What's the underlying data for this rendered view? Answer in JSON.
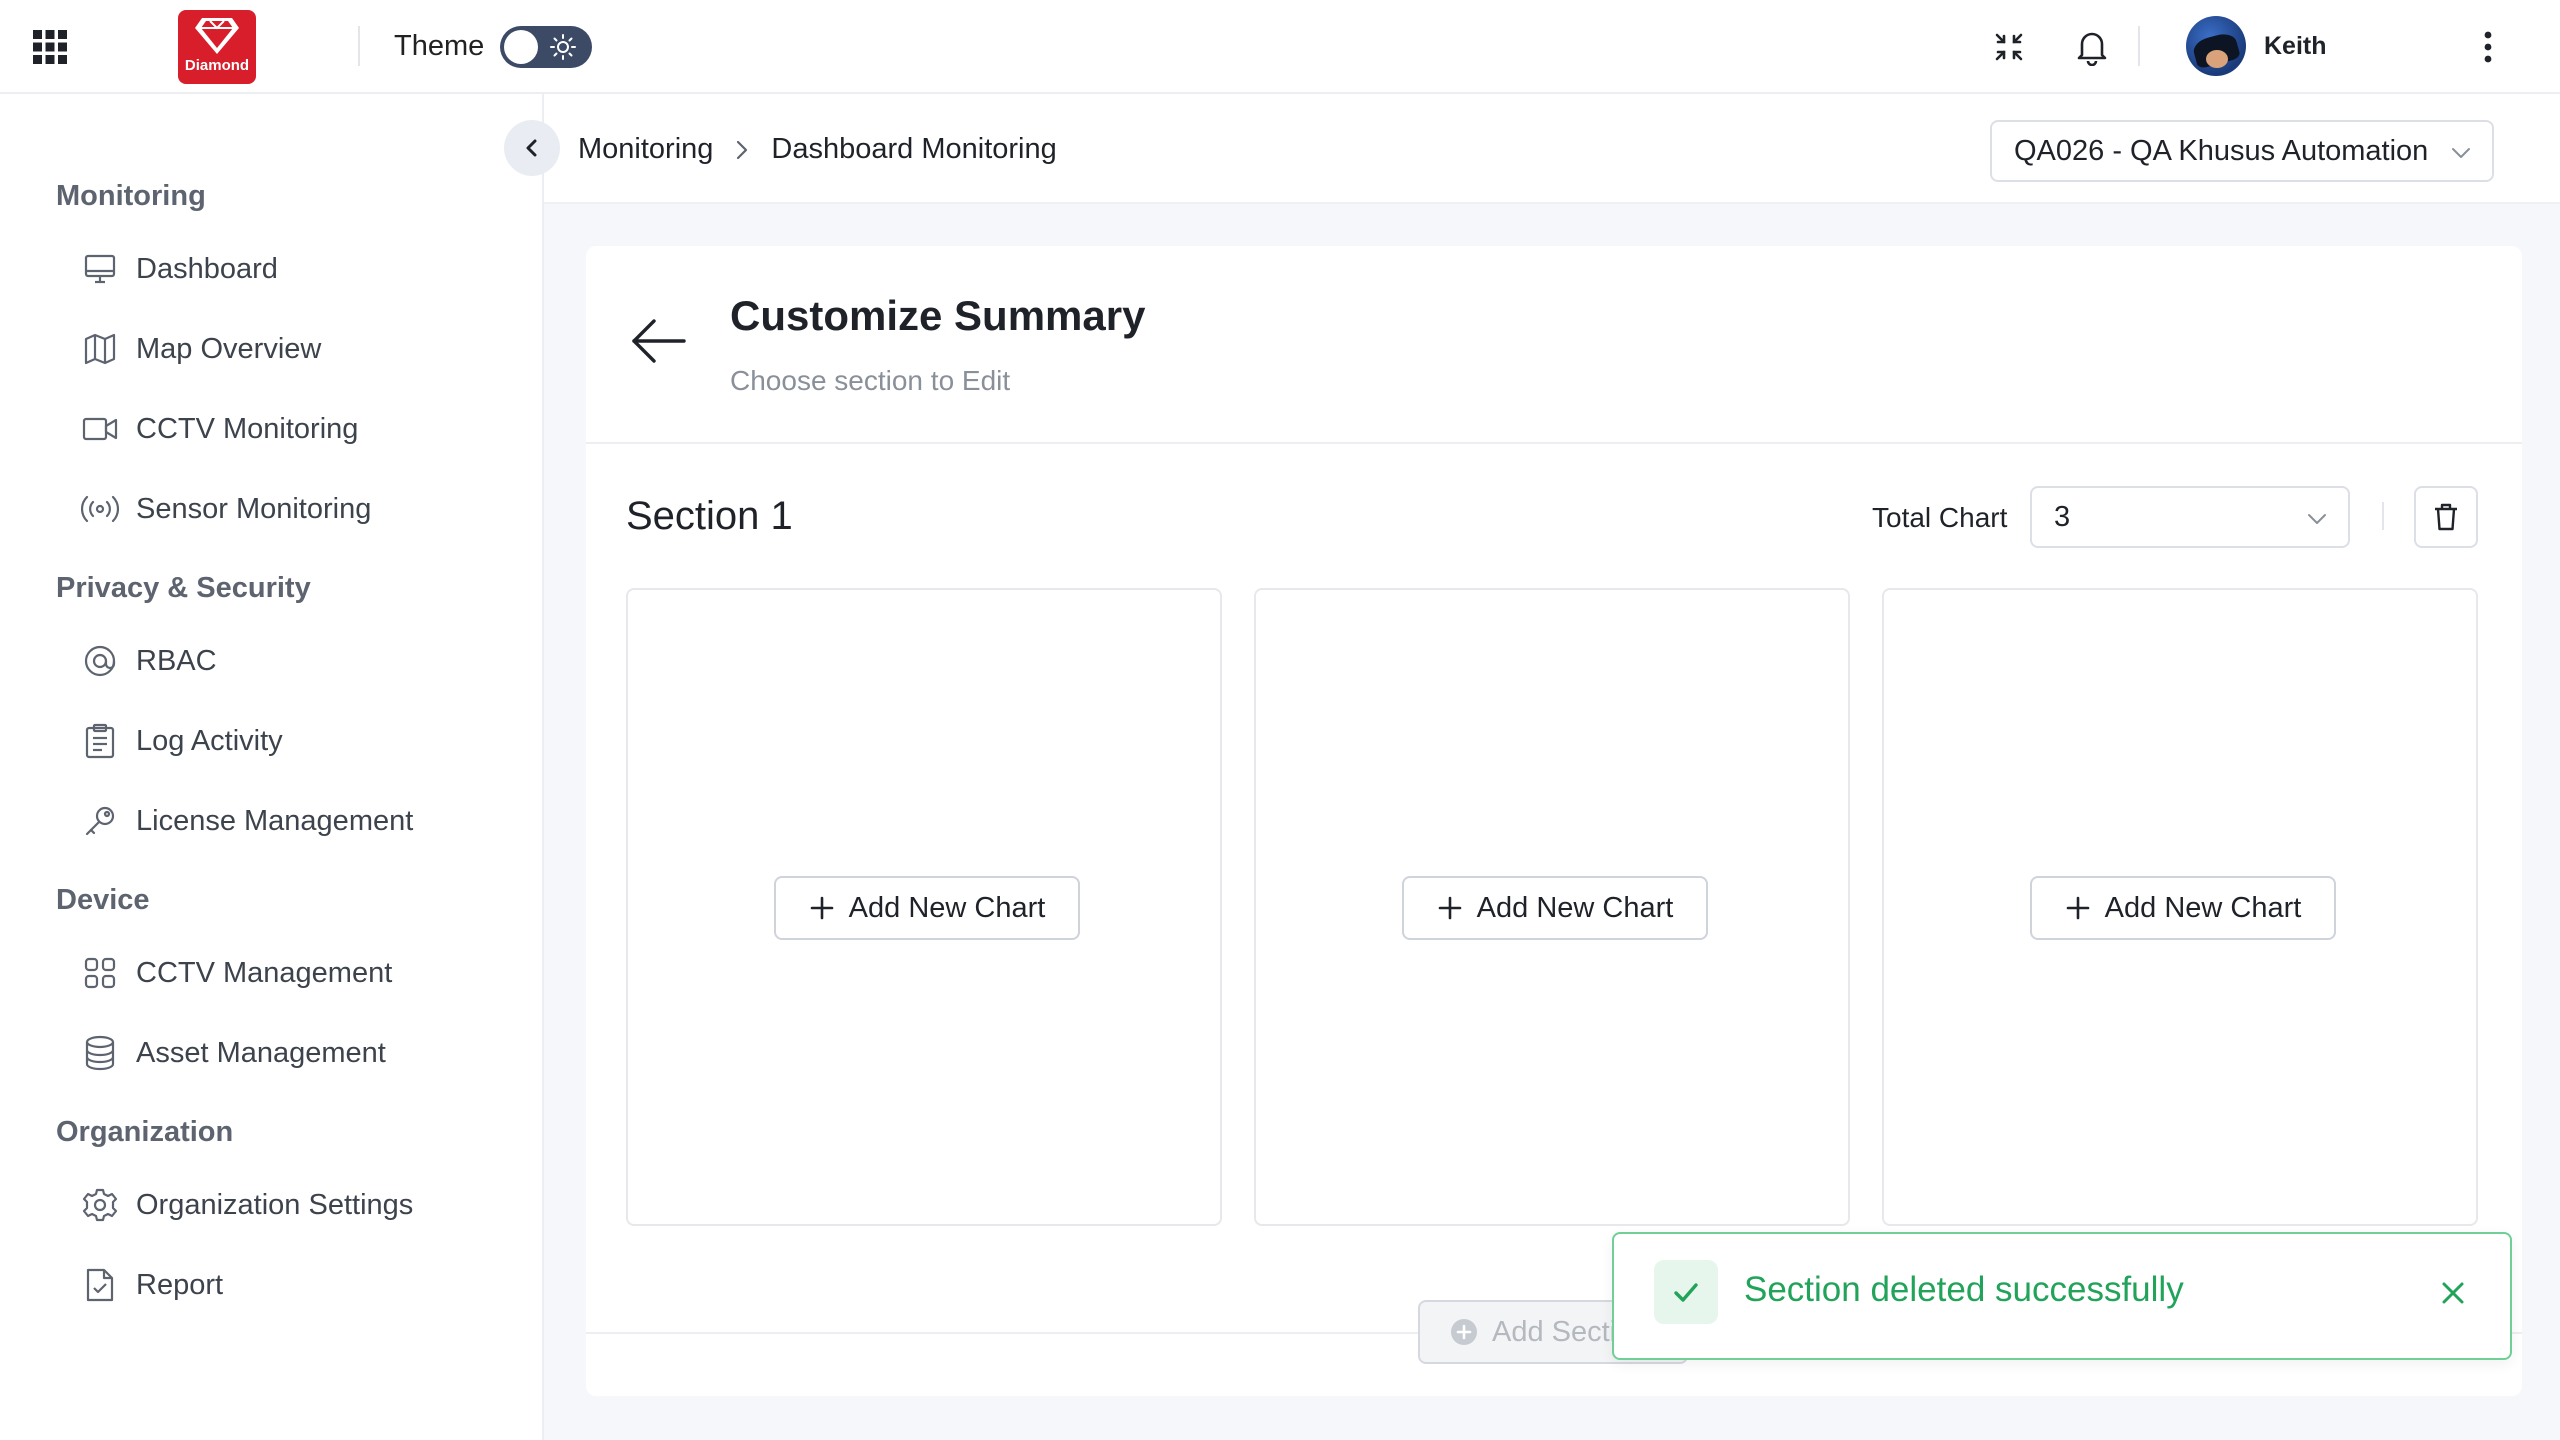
{
  "topbar": {
    "logo_text": "Diamond",
    "theme_label": "Theme",
    "user_name": "Keith",
    "icons": [
      "apps-grid-icon",
      "sun-icon",
      "fullscreen-exit-icon",
      "bell-icon",
      "kebab-menu-icon"
    ]
  },
  "sidebar": {
    "groups": [
      {
        "title": "Monitoring",
        "items": [
          {
            "label": "Dashboard",
            "icon": "monitor-icon"
          },
          {
            "label": "Map Overview",
            "icon": "map-icon"
          },
          {
            "label": "CCTV Monitoring",
            "icon": "video-camera-icon"
          },
          {
            "label": "Sensor Monitoring",
            "icon": "broadcast-icon"
          }
        ]
      },
      {
        "title": "Privacy & Security",
        "items": [
          {
            "label": "RBAC",
            "icon": "at-icon"
          },
          {
            "label": "Log Activity",
            "icon": "clipboard-icon"
          },
          {
            "label": "License Management",
            "icon": "key-icon"
          }
        ]
      },
      {
        "title": "Device",
        "items": [
          {
            "label": "CCTV Management",
            "icon": "grid-icon"
          },
          {
            "label": "Asset Management",
            "icon": "database-icon"
          }
        ]
      },
      {
        "title": "Organization",
        "items": [
          {
            "label": "Organization Settings",
            "icon": "gear-icon"
          },
          {
            "label": "Report",
            "icon": "file-check-icon"
          }
        ]
      }
    ]
  },
  "breadcrumb": {
    "root": "Monitoring",
    "current": "Dashboard Monitoring"
  },
  "org_select": {
    "value": "QA026 - QA Khusus Automation"
  },
  "page": {
    "title": "Customize Summary",
    "subtitle": "Choose section to Edit"
  },
  "section": {
    "title": "Section 1",
    "total_chart_label": "Total Chart",
    "total_chart_value": "3",
    "slots": [
      {
        "button_label": "Add New Chart"
      },
      {
        "button_label": "Add New Chart"
      },
      {
        "button_label": "Add New Chart"
      }
    ]
  },
  "add_section_label": "Add Secti",
  "toast": {
    "message": "Section deleted successfully"
  },
  "colors": {
    "accent_dark": "#3c4a66",
    "brand_red": "#d81e2a",
    "success_green": "#22a35a",
    "success_border": "#6fcf97"
  }
}
